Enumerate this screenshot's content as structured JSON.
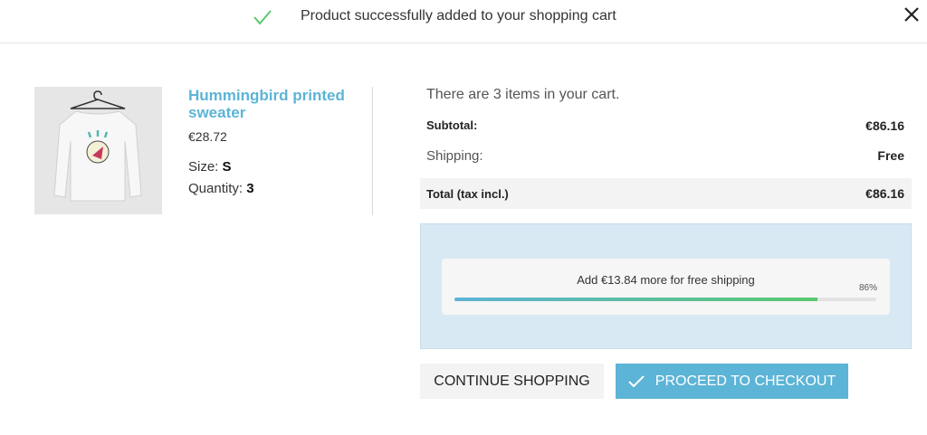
{
  "header": {
    "title": "Product successfully added to your shopping cart",
    "check_icon": "check-icon",
    "close_icon": "close-icon"
  },
  "product": {
    "name": "Hummingbird printed sweater",
    "price": "€28.72",
    "size_label": "Size:",
    "size_value": "S",
    "quantity_label": "Quantity:",
    "quantity_value": "3"
  },
  "cart": {
    "count_text": "There are 3 items in your cart.",
    "subtotal_label": "Subtotal:",
    "subtotal_value": "€86.16",
    "shipping_label": "Shipping:",
    "shipping_value": "Free",
    "total_label": "Total (tax incl.)",
    "total_value": "€86.16"
  },
  "free_shipping": {
    "message": "Add €13.84 more for free shipping",
    "percent_text": "86%",
    "progress_fraction": 0.86
  },
  "actions": {
    "continue_label": "Continue shopping",
    "checkout_label": "Proceed to checkout"
  },
  "colors": {
    "accent": "#5cb4d6",
    "success": "#5ac86f"
  }
}
